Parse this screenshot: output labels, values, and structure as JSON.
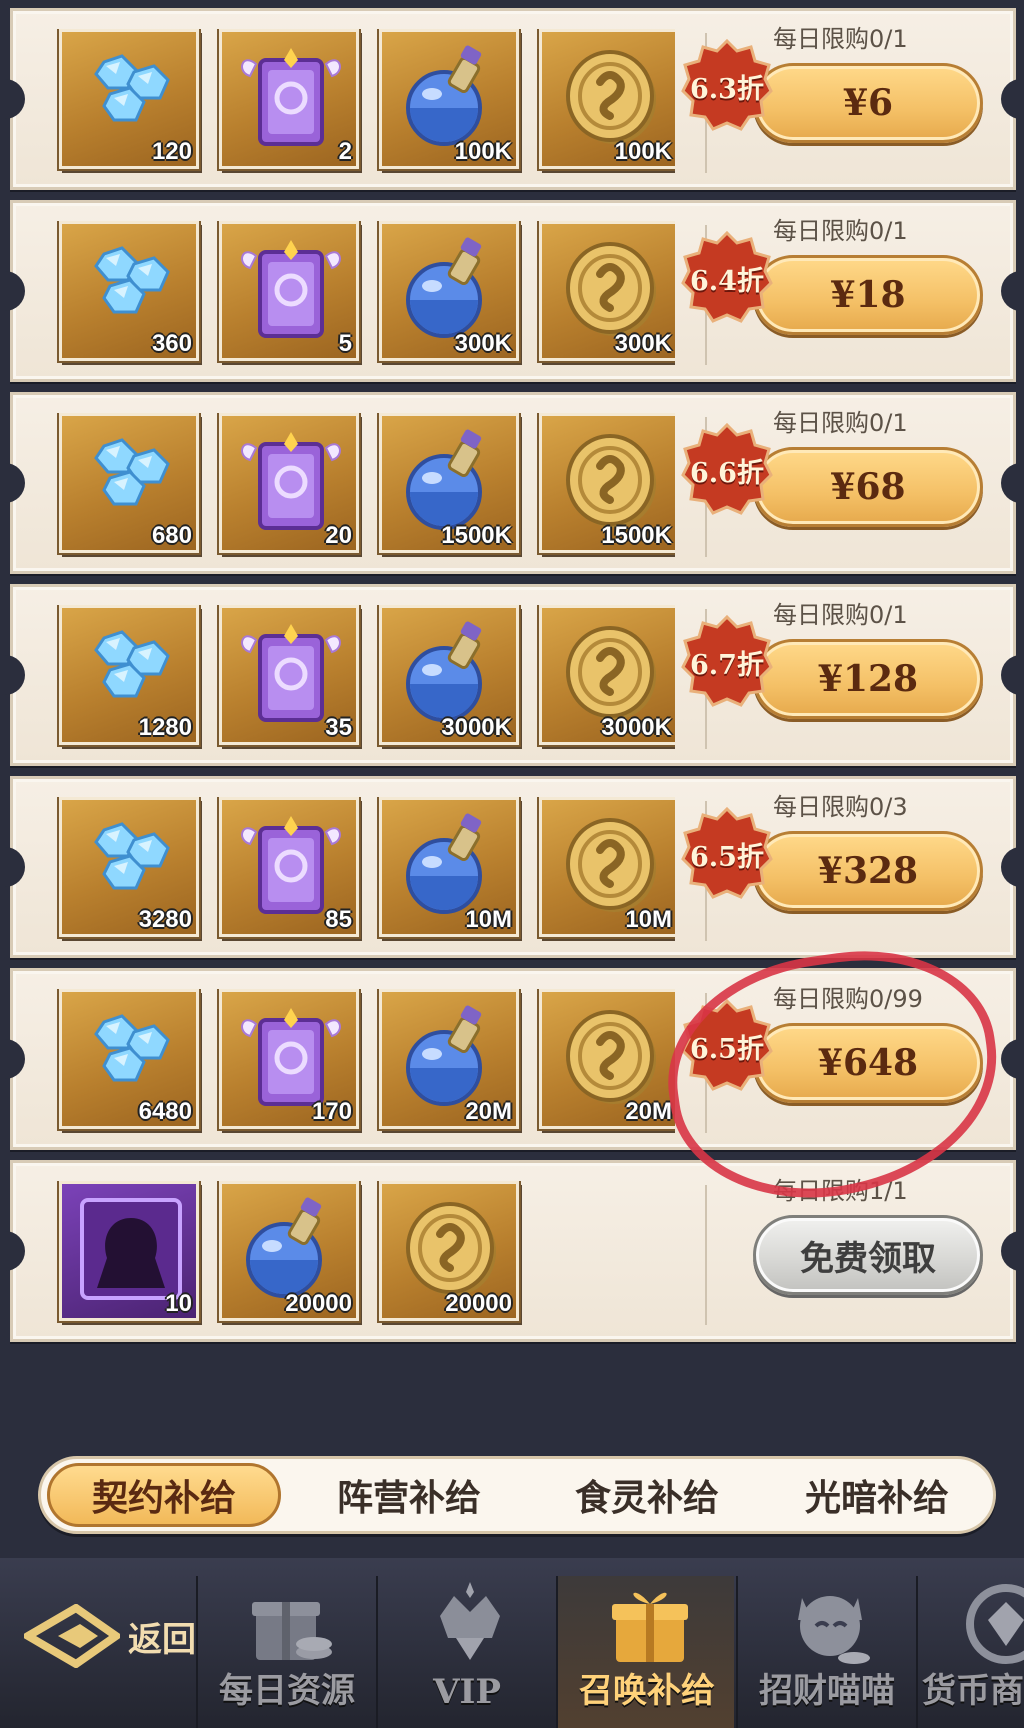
{
  "packs": [
    {
      "limit": "每日限购0/1",
      "discount": "6.3折",
      "price": "¥6",
      "items": [
        {
          "icon": "diamond-icon",
          "qty": "120"
        },
        {
          "icon": "summon-card-icon",
          "qty": "2"
        },
        {
          "icon": "potion-icon",
          "qty": "100K"
        },
        {
          "icon": "coin-icon",
          "qty": "100K"
        }
      ]
    },
    {
      "limit": "每日限购0/1",
      "discount": "6.4折",
      "price": "¥18",
      "items": [
        {
          "icon": "diamond-icon",
          "qty": "360"
        },
        {
          "icon": "summon-card-icon",
          "qty": "5"
        },
        {
          "icon": "potion-icon",
          "qty": "300K"
        },
        {
          "icon": "coin-icon",
          "qty": "300K"
        }
      ]
    },
    {
      "limit": "每日限购0/1",
      "discount": "6.6折",
      "price": "¥68",
      "items": [
        {
          "icon": "diamond-icon",
          "qty": "680"
        },
        {
          "icon": "summon-card-icon",
          "qty": "20"
        },
        {
          "icon": "potion-icon",
          "qty": "1500K"
        },
        {
          "icon": "coin-icon",
          "qty": "1500K"
        }
      ]
    },
    {
      "limit": "每日限购0/1",
      "discount": "6.7折",
      "price": "¥128",
      "items": [
        {
          "icon": "diamond-icon",
          "qty": "1280"
        },
        {
          "icon": "summon-card-icon",
          "qty": "35"
        },
        {
          "icon": "potion-icon",
          "qty": "3000K"
        },
        {
          "icon": "coin-icon",
          "qty": "3000K"
        }
      ]
    },
    {
      "limit": "每日限购0/3",
      "discount": "6.5折",
      "price": "¥328",
      "items": [
        {
          "icon": "diamond-icon",
          "qty": "3280"
        },
        {
          "icon": "summon-card-icon",
          "qty": "85"
        },
        {
          "icon": "potion-icon",
          "qty": "10M"
        },
        {
          "icon": "coin-icon",
          "qty": "10M"
        }
      ]
    },
    {
      "limit": "每日限购0/99",
      "discount": "6.5折",
      "price": "¥648",
      "items": [
        {
          "icon": "diamond-icon",
          "qty": "6480"
        },
        {
          "icon": "summon-card-icon",
          "qty": "170"
        },
        {
          "icon": "potion-icon",
          "qty": "20M"
        },
        {
          "icon": "coin-icon",
          "qty": "20M"
        }
      ]
    },
    {
      "limit": "每日限购1/1",
      "discount": "",
      "price": "免费领取",
      "items": [
        {
          "icon": "hero-portrait-icon",
          "qty": "10"
        },
        {
          "icon": "potion-icon",
          "qty": "20000"
        },
        {
          "icon": "coin-icon",
          "qty": "20000"
        }
      ]
    }
  ],
  "tabs": [
    "契约补给",
    "阵营补给",
    "食灵补给",
    "光暗补给"
  ],
  "active_tab": 0,
  "nav": {
    "back_label": "返回",
    "items": [
      {
        "label": "每日资源",
        "icon": "gift-coins-icon"
      },
      {
        "label": "VIP",
        "icon": "crown-gem-icon"
      },
      {
        "label": "召唤补给",
        "icon": "gift-box-icon"
      },
      {
        "label": "招财喵喵",
        "icon": "lucky-cat-icon"
      },
      {
        "label": "货币商",
        "icon": "diamond-shop-icon"
      }
    ],
    "active_index": 2
  },
  "colors": {
    "accent": "#f4c066",
    "badge": "#c53a22",
    "highlight_circle": "#d83546"
  }
}
